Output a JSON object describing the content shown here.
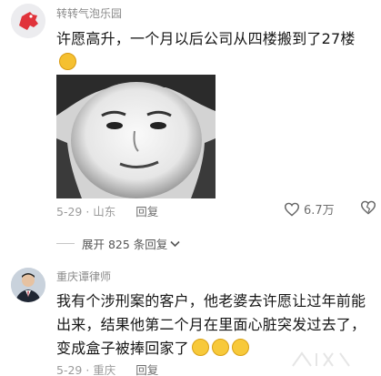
{
  "comments": [
    {
      "username": "转转气泡乐园",
      "text": "许愿高升，一个月以后公司从四楼搬到了27楼",
      "date_location": "5-29 · 山东",
      "reply_label": "回复",
      "like_count": "6.7万",
      "expand_label": "展开 825 条回复"
    },
    {
      "username": "重庆谭律师",
      "text": "我有个涉刑案的客户，他老婆去许愿让过年前能出来，结果他第二个月在里面心脏突发过去了，变成盒子被捧回家了",
      "date_location": "5-29 · 重庆",
      "reply_label": "回复"
    }
  ],
  "colors": {
    "accent_red": "#e0333b",
    "emoji_yellow": "#f5c030"
  }
}
